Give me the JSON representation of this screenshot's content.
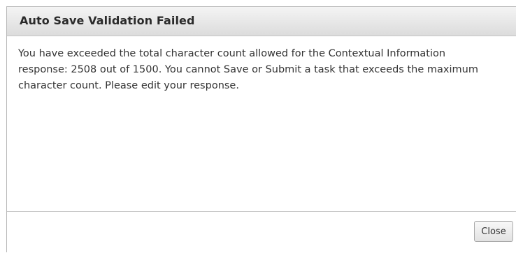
{
  "dialog": {
    "title": "Auto Save Validation Failed",
    "message": "You have exceeded the total character count allowed for the Contextual Information response: 2508 out of 1500. You cannot Save or Submit a task that exceeds the maximum character count. Please edit your response.",
    "close_label": "Close"
  }
}
